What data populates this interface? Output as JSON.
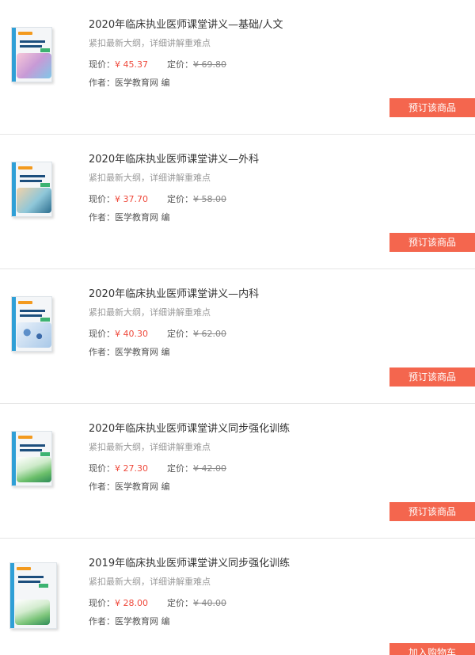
{
  "labels": {
    "current_price": "现价：",
    "original_price": "定价：",
    "author": "作者："
  },
  "products": [
    {
      "title": "2020年临床执业医师课堂讲义—基础/人文",
      "subtitle": "紧扣最新大纲，详细讲解重难点",
      "current_price": "¥ 45.37",
      "original_price": "¥ 69.80",
      "author": "医学教育网 编",
      "button": "预订该商品"
    },
    {
      "title": "2020年临床执业医师课堂讲义—外科",
      "subtitle": "紧扣最新大纲，详细讲解重难点",
      "current_price": "¥ 37.70",
      "original_price": "¥ 58.00",
      "author": "医学教育网 编",
      "button": "预订该商品"
    },
    {
      "title": "2020年临床执业医师课堂讲义—内科",
      "subtitle": "紧扣最新大纲，详细讲解重难点",
      "current_price": "¥ 40.30",
      "original_price": "¥ 62.00",
      "author": "医学教育网 编",
      "button": "预订该商品"
    },
    {
      "title": "2020年临床执业医师课堂讲义同步强化训练",
      "subtitle": "紧扣最新大纲，详细讲解重难点",
      "current_price": "¥ 27.30",
      "original_price": "¥ 42.00",
      "author": "医学教育网 编",
      "button": "预订该商品"
    },
    {
      "title": "2019年临床执业医师课堂讲义同步强化训练",
      "subtitle": "紧扣最新大纲，详细讲解重难点",
      "current_price": "¥ 28.00",
      "original_price": "¥ 40.00",
      "author": "医学教育网 编",
      "button": "加入购物车"
    }
  ],
  "colors": {
    "accent": "#f4664e",
    "price": "#ef4a3c",
    "divider": "#e6e6e6"
  }
}
